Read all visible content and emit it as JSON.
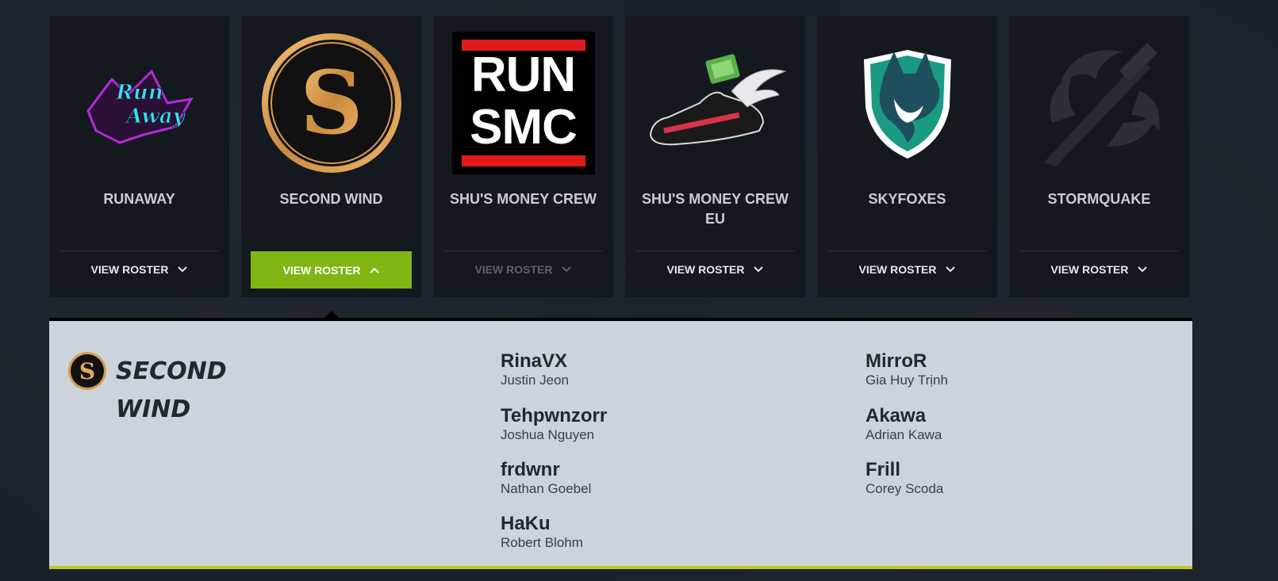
{
  "teams": [
    {
      "name": "RUNAWAY",
      "button": "VIEW ROSTER",
      "state": "default",
      "logo": "runaway-logo"
    },
    {
      "name": "SECOND WIND",
      "button": "VIEW ROSTER",
      "state": "active",
      "logo": "second-wind-logo"
    },
    {
      "name": "SHU'S MONEY CREW",
      "button": "VIEW ROSTER",
      "state": "dim",
      "logo": "run-smc-logo",
      "logo_text": [
        "RUN",
        "SMC"
      ]
    },
    {
      "name": "SHU'S MONEY CREW EU",
      "button": "VIEW ROSTER",
      "state": "default",
      "logo": "winged-shoe-logo"
    },
    {
      "name": "SKYFOXES",
      "button": "VIEW ROSTER",
      "state": "default",
      "logo": "skyfox-logo"
    },
    {
      "name": "STORMQUAKE",
      "button": "VIEW ROSTER",
      "state": "default",
      "logo": "stormquake-logo"
    }
  ],
  "roster": {
    "title_line1": "SECOND",
    "title_line2": "WIND",
    "players": [
      {
        "gamertag": "RinaVX",
        "real_name": "Justin Jeon"
      },
      {
        "gamertag": "MirroR",
        "real_name": "Gia Huy Trịnh"
      },
      {
        "gamertag": "Tehpwnzorr",
        "real_name": "Joshua Nguyen"
      },
      {
        "gamertag": "Akawa",
        "real_name": "Adrian Kawa"
      },
      {
        "gamertag": "frdwnr",
        "real_name": "Nathan Goebel"
      },
      {
        "gamertag": "Frill",
        "real_name": "Corey Scoda"
      },
      {
        "gamertag": "HaKu",
        "real_name": "Robert Blohm"
      }
    ]
  },
  "colors": {
    "active_button": "#7fb614",
    "panel_bg": "#cbd3dc",
    "panel_accent": "#c5c91a",
    "card_bg": "#14181f"
  }
}
